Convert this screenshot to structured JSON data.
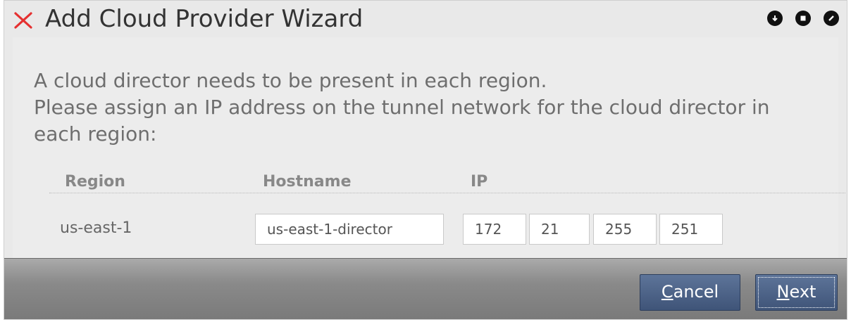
{
  "window": {
    "title": "Add Cloud Provider Wizard",
    "controls": [
      "minimize-icon",
      "maximize-icon",
      "close-icon"
    ]
  },
  "intro": {
    "line1": "A cloud director needs to be present in each region.",
    "line2": "Please assign an IP address on the tunnel network for the cloud director in",
    "line3": "each region:"
  },
  "table": {
    "headers": {
      "region": "Region",
      "hostname": "Hostname",
      "ip": "IP"
    },
    "rows": [
      {
        "region": "us-east-1",
        "hostname": "us-east-1-director",
        "ip": [
          "172",
          "21",
          "255",
          "251"
        ]
      }
    ]
  },
  "footer": {
    "cancel_label_u": "C",
    "cancel_label_rest": "ancel",
    "next_label_u": "N",
    "next_label_rest": "ext"
  },
  "colors": {
    "button": "#4a6088",
    "footer": "#8a8a8a",
    "title_x": "#e53030"
  }
}
